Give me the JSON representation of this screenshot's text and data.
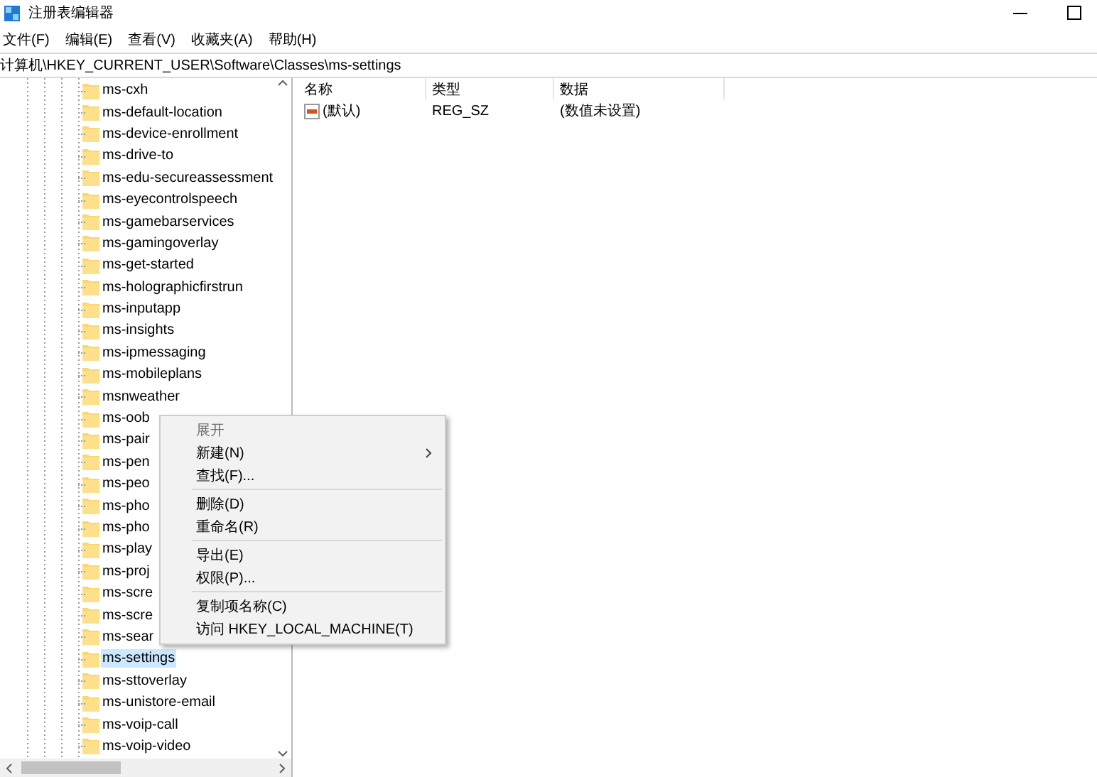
{
  "window": {
    "title": "注册表编辑器"
  },
  "menu_bar": [
    "文件(F)",
    "编辑(E)",
    "查看(V)",
    "收藏夹(A)",
    "帮助(H)"
  ],
  "address": "计算机\\HKEY_CURRENT_USER\\Software\\Classes\\ms-settings",
  "tree": {
    "items": [
      {
        "label": "ms-cxh",
        "selected": false
      },
      {
        "label": "ms-default-location",
        "selected": false
      },
      {
        "label": "ms-device-enrollment",
        "selected": false
      },
      {
        "label": "ms-drive-to",
        "selected": false
      },
      {
        "label": "ms-edu-secureassessment",
        "selected": false
      },
      {
        "label": "ms-eyecontrolspeech",
        "selected": false
      },
      {
        "label": "ms-gamebarservices",
        "selected": false
      },
      {
        "label": "ms-gamingoverlay",
        "selected": false
      },
      {
        "label": "ms-get-started",
        "selected": false
      },
      {
        "label": "ms-holographicfirstrun",
        "selected": false
      },
      {
        "label": "ms-inputapp",
        "selected": false
      },
      {
        "label": "ms-insights",
        "selected": false
      },
      {
        "label": "ms-ipmessaging",
        "selected": false
      },
      {
        "label": "ms-mobileplans",
        "selected": false
      },
      {
        "label": "msnweather",
        "selected": false
      },
      {
        "label": "ms-oob",
        "selected": false
      },
      {
        "label": "ms-pair",
        "selected": false
      },
      {
        "label": "ms-pen",
        "selected": false
      },
      {
        "label": "ms-peo",
        "selected": false
      },
      {
        "label": "ms-pho",
        "selected": false
      },
      {
        "label": "ms-pho",
        "selected": false
      },
      {
        "label": "ms-play",
        "selected": false
      },
      {
        "label": "ms-proj",
        "selected": false
      },
      {
        "label": "ms-scre",
        "selected": false
      },
      {
        "label": "ms-scre",
        "selected": false
      },
      {
        "label": "ms-sear",
        "selected": false
      },
      {
        "label": "ms-settings",
        "selected": true
      },
      {
        "label": "ms-sttoverlay",
        "selected": false
      },
      {
        "label": "ms-unistore-email",
        "selected": false
      },
      {
        "label": "ms-voip-call",
        "selected": false
      },
      {
        "label": "ms-voip-video",
        "selected": false
      }
    ]
  },
  "list_view": {
    "columns": [
      "名称",
      "类型",
      "数据"
    ],
    "rows": [
      {
        "name": "(默认)",
        "type": "REG_SZ",
        "data": "(数值未设置)"
      }
    ]
  },
  "context_menu": [
    {
      "kind": "item",
      "label": "展开",
      "disabled": true,
      "submenu": false
    },
    {
      "kind": "item",
      "label": "新建(N)",
      "disabled": false,
      "submenu": true
    },
    {
      "kind": "item",
      "label": "查找(F)...",
      "disabled": false,
      "submenu": false
    },
    {
      "kind": "separator"
    },
    {
      "kind": "item",
      "label": "删除(D)",
      "disabled": false,
      "submenu": false
    },
    {
      "kind": "item",
      "label": "重命名(R)",
      "disabled": false,
      "submenu": false
    },
    {
      "kind": "separator"
    },
    {
      "kind": "item",
      "label": "导出(E)",
      "disabled": false,
      "submenu": false
    },
    {
      "kind": "item",
      "label": "权限(P)...",
      "disabled": false,
      "submenu": false
    },
    {
      "kind": "separator"
    },
    {
      "kind": "item",
      "label": "复制项名称(C)",
      "disabled": false,
      "submenu": false
    },
    {
      "kind": "item",
      "label": "访问 HKEY_LOCAL_MACHINE(T)",
      "disabled": false,
      "submenu": false
    }
  ]
}
